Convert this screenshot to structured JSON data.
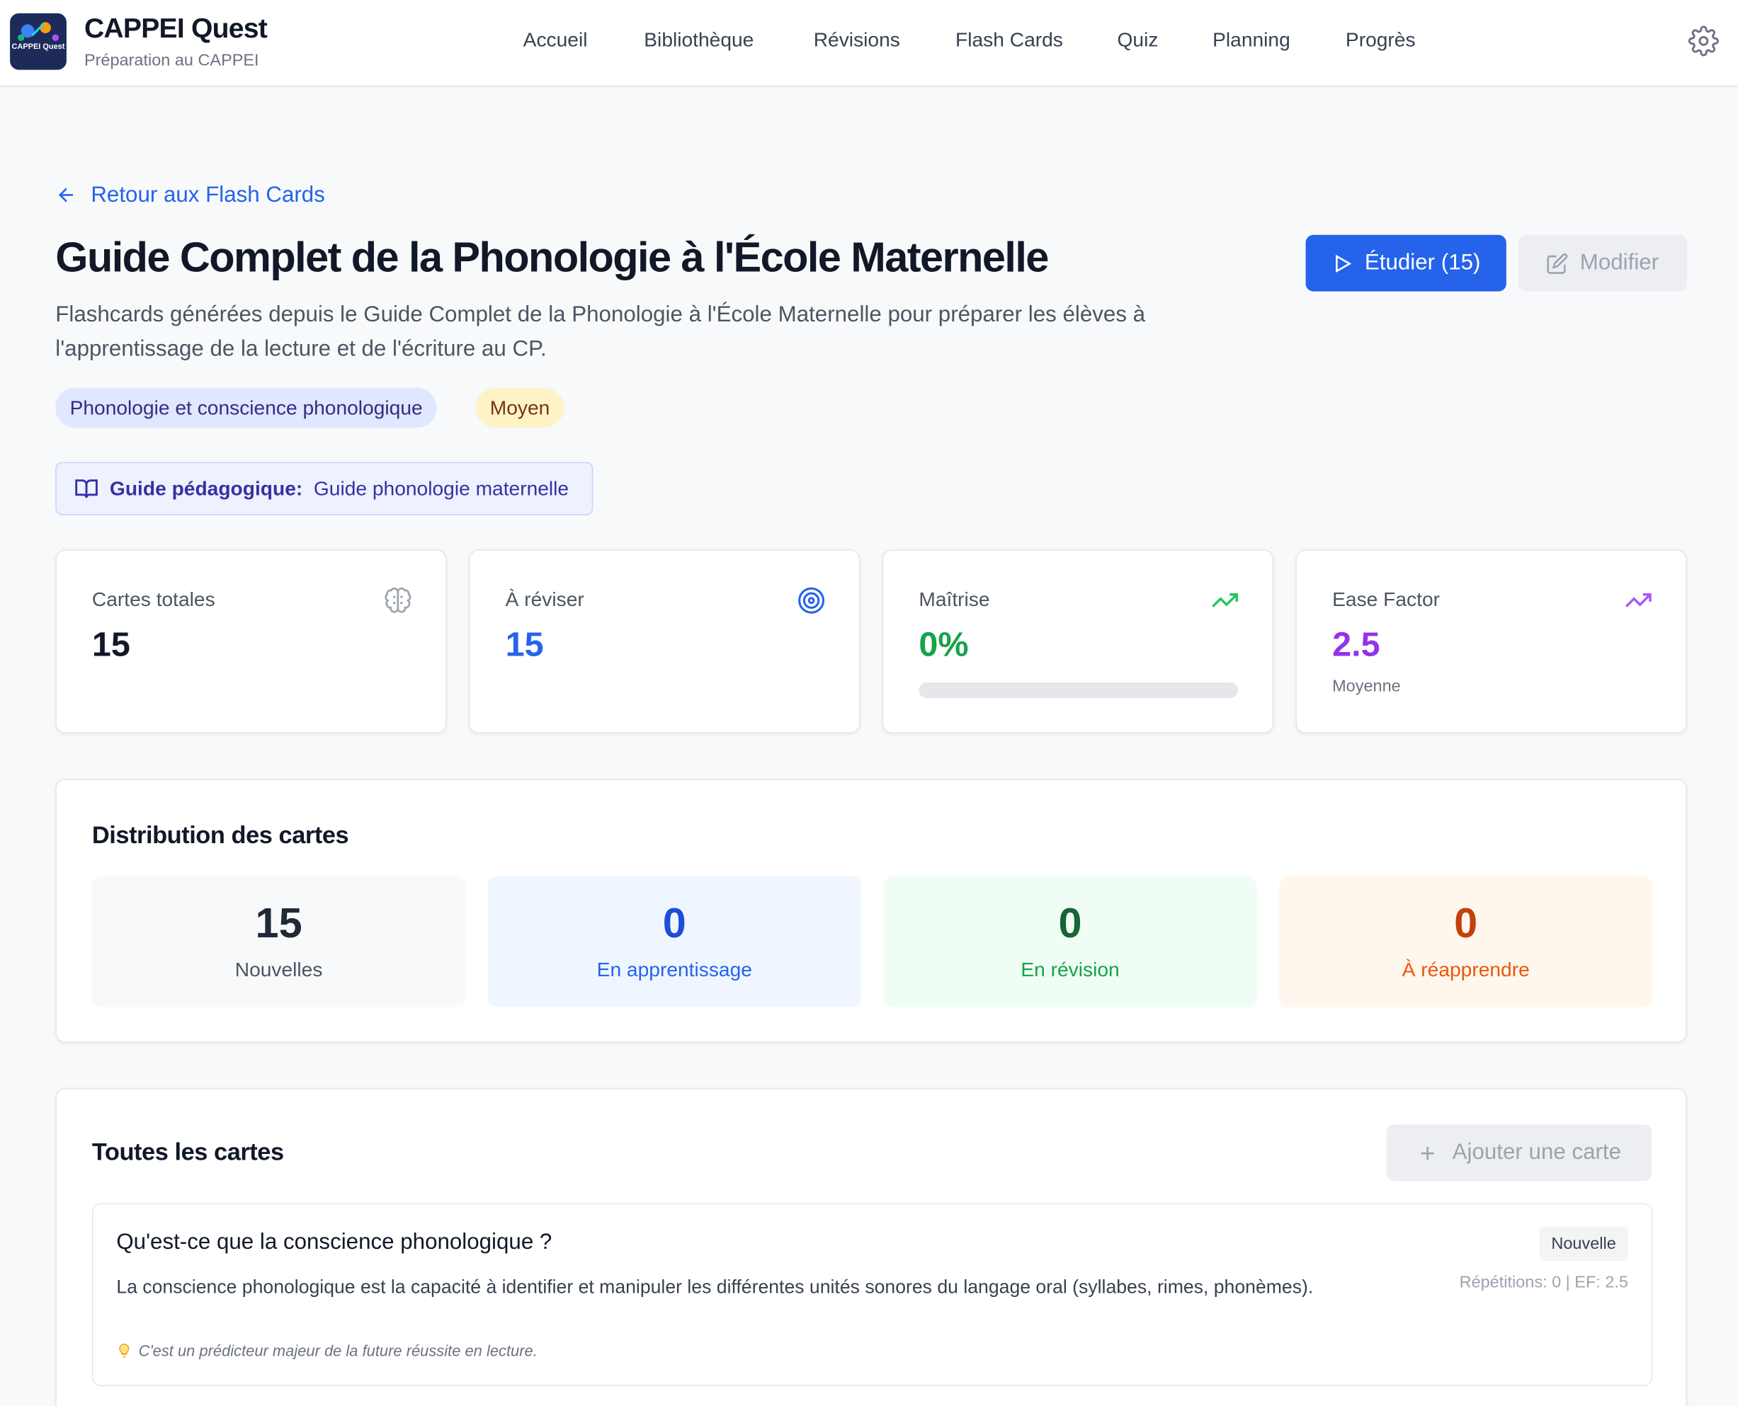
{
  "app": {
    "title": "CAPPEI Quest",
    "subtitle": "Préparation au CAPPEI",
    "logo_text": "CAPPEI Quest"
  },
  "nav": {
    "items": [
      "Accueil",
      "Bibliothèque",
      "Révisions",
      "Flash Cards",
      "Quiz",
      "Planning",
      "Progrès"
    ]
  },
  "back_link": "Retour aux Flash Cards",
  "deck": {
    "title": "Guide Complet de la Phonologie à l'École Maternelle",
    "description": "Flashcards générées depuis le Guide Complet de la Phonologie à l'École Maternelle pour préparer les élèves à l'apprentissage de la lecture et de l'écriture au CP.",
    "tags": [
      "Phonologie et conscience phonologique",
      "Moyen"
    ],
    "guide_label": "Guide pédagogique:",
    "guide_name": "Guide phonologie maternelle"
  },
  "actions": {
    "study": "Étudier (15)",
    "edit": "Modifier",
    "add_card": "Ajouter une carte"
  },
  "stats": [
    {
      "label": "Cartes totales",
      "value": "15",
      "icon": "brain-icon"
    },
    {
      "label": "À réviser",
      "value": "15",
      "icon": "target-icon"
    },
    {
      "label": "Maîtrise",
      "value": "0%",
      "icon": "trending-up-icon",
      "progress": 0
    },
    {
      "label": "Ease Factor",
      "value": "2.5",
      "sub": "Moyenne",
      "icon": "trending-up-icon"
    }
  ],
  "distribution": {
    "title": "Distribution des cartes",
    "items": [
      {
        "value": "15",
        "label": "Nouvelles"
      },
      {
        "value": "0",
        "label": "En apprentissage"
      },
      {
        "value": "0",
        "label": "En révision"
      },
      {
        "value": "0",
        "label": "À réapprendre"
      }
    ]
  },
  "cards_section": {
    "title": "Toutes les cartes",
    "cards": [
      {
        "question": "Qu'est-ce que la conscience phonologique ?",
        "answer": "La conscience phonologique est la capacité à identifier et manipuler les différentes unités sonores du langage oral (syllabes, rimes, phonèmes).",
        "tip": "C'est un prédicteur majeur de la future réussite en lecture.",
        "status": "Nouvelle",
        "meta": "Répétitions: 0 | EF: 2.5"
      }
    ]
  },
  "colors": {
    "primary": "#2563eb",
    "blue_value": "#2563eb",
    "green_value": "#16a34a",
    "purple_value": "#9333ea",
    "orange_value": "#c2410c"
  }
}
